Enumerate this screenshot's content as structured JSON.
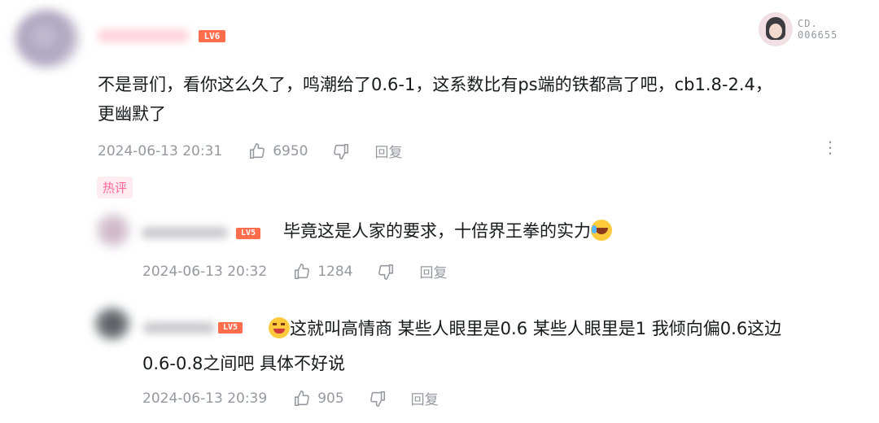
{
  "colors": {
    "text": "#18191c",
    "meta": "#9499a0",
    "level_badge": "#ff6d4c",
    "hot_tag_text": "#ff6699",
    "hot_tag_bg": "#ffecf1"
  },
  "fan_badge": {
    "line1": "CD.",
    "line2": "006655"
  },
  "comment": {
    "level": "LV6",
    "text_line1": "不是哥们，看你这么久了，鸣潮给了0.6-1，这系数比有ps端的铁都高了吧，cb1.8-2.4，",
    "text_line2": "更幽默了",
    "time": "2024-06-13 20:31",
    "likes": "6950",
    "reply_label": "回复",
    "more_icon": "more-vertical-icon",
    "hot_tag": "热评"
  },
  "replies": [
    {
      "level": "LV5",
      "text_line1": "毕竟这是人家的要求，十倍界王拳的实力",
      "emoji": "laughing-tears-emoji",
      "time": "2024-06-13 20:32",
      "likes": "1284",
      "reply_label": "回复"
    },
    {
      "level": "LV5",
      "emoji": "smirk-emoji",
      "text_line1": "这就叫高情商 某些人眼里是0.6 某些人眼里是1 我倾向偏0.6这边",
      "text_line2": "0.6-0.8之间吧 具体不好说",
      "time": "2024-06-13 20:39",
      "likes": "905",
      "reply_label": "回复"
    }
  ]
}
